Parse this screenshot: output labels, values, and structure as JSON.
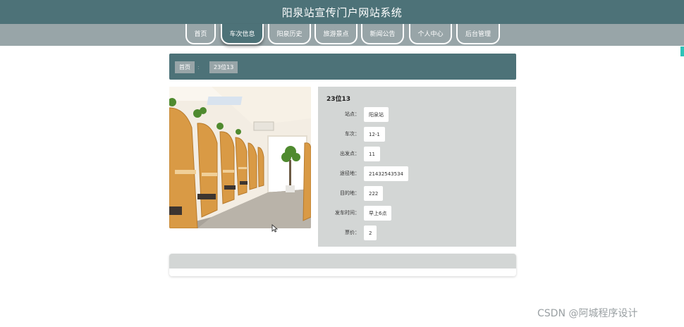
{
  "header": {
    "title": "阳泉站宣传门户网站系统"
  },
  "nav": {
    "items": [
      {
        "label": "首页"
      },
      {
        "label": "车次信息"
      },
      {
        "label": "阳泉历史"
      },
      {
        "label": "旅游景点"
      },
      {
        "label": "新闻公告"
      },
      {
        "label": "个人中心"
      },
      {
        "label": "后台管理"
      }
    ],
    "active_index": 1
  },
  "breadcrumb": {
    "home": "首页",
    "separator": ":",
    "current": "23位13"
  },
  "detail": {
    "title": "23位13",
    "fields": [
      {
        "label": "站点：",
        "value": "阳泉站"
      },
      {
        "label": "车次：",
        "value": "12-1"
      },
      {
        "label": "出发点：",
        "value": "11"
      },
      {
        "label": "途径地：",
        "value": "21432543534"
      },
      {
        "label": "目的地：",
        "value": "222"
      },
      {
        "label": "发车时间：",
        "value": "早上6点"
      },
      {
        "label": "票价：",
        "value": "2"
      }
    ]
  },
  "watermark": "CSDN @阿城程序设计",
  "colors": {
    "primary": "#4d7278",
    "secondary": "#98a5a8",
    "panel": "#d3d6d5",
    "accent": "#2fc3b8"
  }
}
